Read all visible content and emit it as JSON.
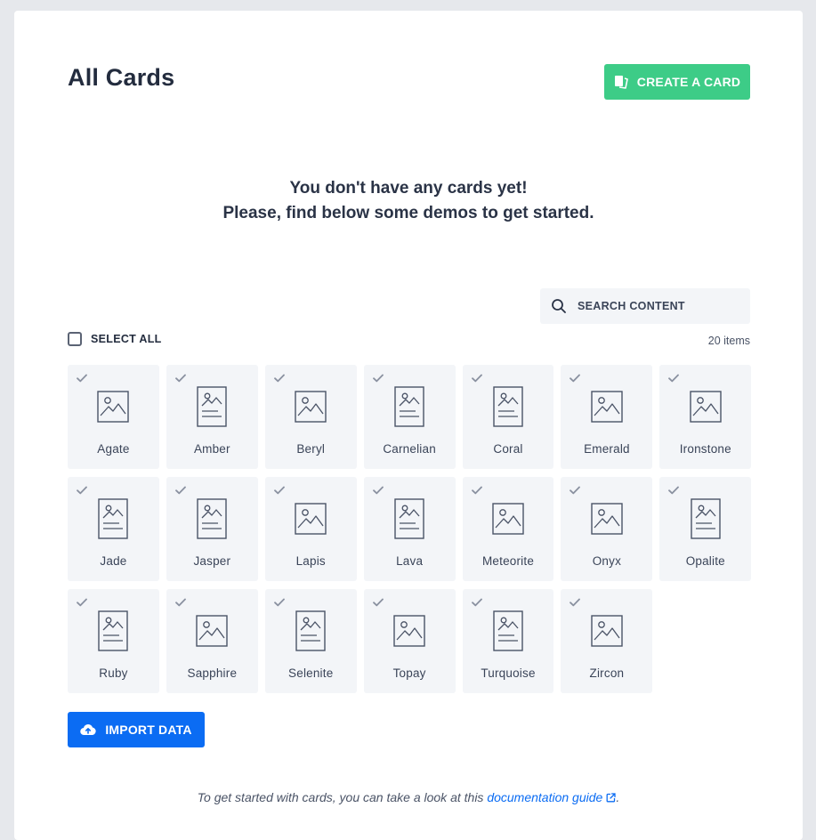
{
  "header": {
    "title": "All Cards",
    "create_label": "CREATE A CARD"
  },
  "empty_state": {
    "line1": "You don't have any cards yet!",
    "line2": "Please, find below some demos to get started."
  },
  "search": {
    "placeholder": "SEARCH CONTENT"
  },
  "selection": {
    "select_all_label": "SELECT ALL",
    "select_all_checked": false,
    "item_count": "20 items"
  },
  "cards": [
    {
      "name": "Agate",
      "icon": "image-icon"
    },
    {
      "name": "Amber",
      "icon": "document-image-icon"
    },
    {
      "name": "Beryl",
      "icon": "image-icon"
    },
    {
      "name": "Carnelian",
      "icon": "document-image-icon"
    },
    {
      "name": "Coral",
      "icon": "document-image-icon"
    },
    {
      "name": "Emerald",
      "icon": "image-icon"
    },
    {
      "name": "Ironstone",
      "icon": "image-icon"
    },
    {
      "name": "Jade",
      "icon": "document-image-icon"
    },
    {
      "name": "Jasper",
      "icon": "document-image-icon"
    },
    {
      "name": "Lapis",
      "icon": "image-icon"
    },
    {
      "name": "Lava",
      "icon": "document-image-icon"
    },
    {
      "name": "Meteorite",
      "icon": "image-icon"
    },
    {
      "name": "Onyx",
      "icon": "image-icon"
    },
    {
      "name": "Opalite",
      "icon": "document-image-icon"
    },
    {
      "name": "Ruby",
      "icon": "document-image-icon"
    },
    {
      "name": "Sapphire",
      "icon": "image-icon"
    },
    {
      "name": "Selenite",
      "icon": "document-image-icon"
    },
    {
      "name": "Topay",
      "icon": "image-icon"
    },
    {
      "name": "Turquoise",
      "icon": "document-image-icon"
    },
    {
      "name": "Zircon",
      "icon": "image-icon"
    }
  ],
  "import": {
    "label": "IMPORT DATA"
  },
  "footer": {
    "text": "To get started with cards, you can take a look at this ",
    "link_text": "documentation guide",
    "suffix": "."
  },
  "colors": {
    "primary": "#0b6cf3",
    "success": "#3dcc87",
    "text": "#2a3346",
    "card_bg": "#f3f5f8"
  }
}
